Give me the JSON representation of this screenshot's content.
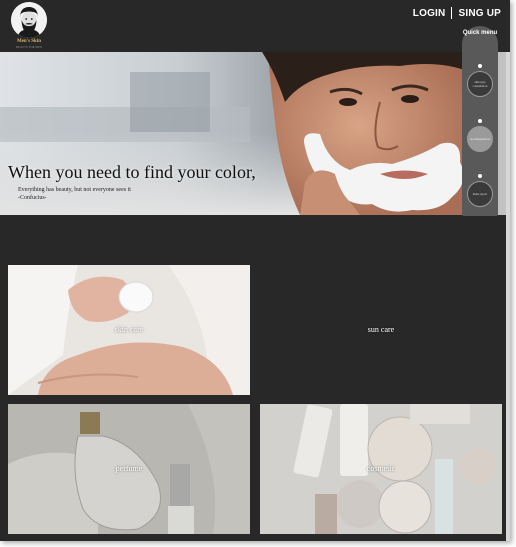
{
  "header": {
    "logo": {
      "text": "Men's Skin",
      "subtext": "BEAUTY FOR MEN"
    },
    "nav": {
      "login": "LOGIN",
      "signup": "SING UP"
    }
  },
  "hero": {
    "headline": "When you need to find your color,",
    "quote_line1": "Everything has beauty, but not everyone sees it",
    "quote_line2": "-Confucius-"
  },
  "quick_menu": {
    "label": "Quick menu",
    "items": [
      "skin type consultation",
      "recommendation",
      "make report"
    ]
  },
  "tiles": [
    {
      "label": "skin care"
    },
    {
      "label": "sun care"
    },
    {
      "label": "perfume"
    },
    {
      "label": "cosmetic"
    }
  ]
}
